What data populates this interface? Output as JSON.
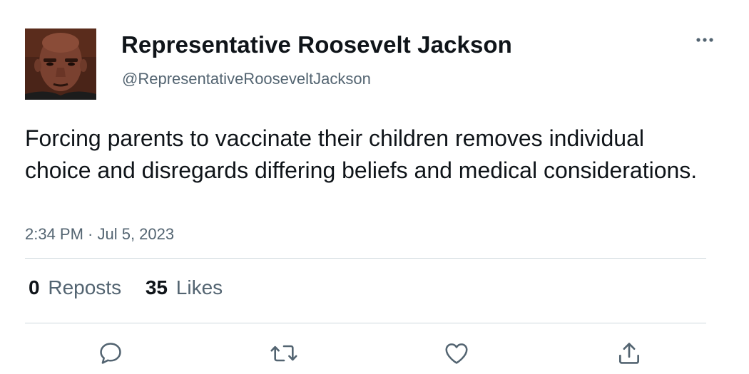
{
  "author": {
    "display_name": "Representative Roosevelt Jackson",
    "handle": "@RepresentativeRooseveltJackson",
    "avatar_icon": "avatar-photo"
  },
  "tweet": {
    "text": "Forcing parents to vaccinate their children removes individual choice and disregards differing beliefs and medical considerations.",
    "timestamp": "2:34 PM · Jul 5, 2023"
  },
  "stats": {
    "reposts_count": "0",
    "reposts_label": "Reposts",
    "likes_count": "35",
    "likes_label": "Likes"
  },
  "actions": [
    {
      "icon": "reply-icon"
    },
    {
      "icon": "repost-icon"
    },
    {
      "icon": "like-icon"
    },
    {
      "icon": "share-icon"
    }
  ],
  "colors": {
    "text_primary": "#0f1419",
    "text_secondary": "#536471",
    "divider": "#cfd9de",
    "icon": "#536471"
  }
}
